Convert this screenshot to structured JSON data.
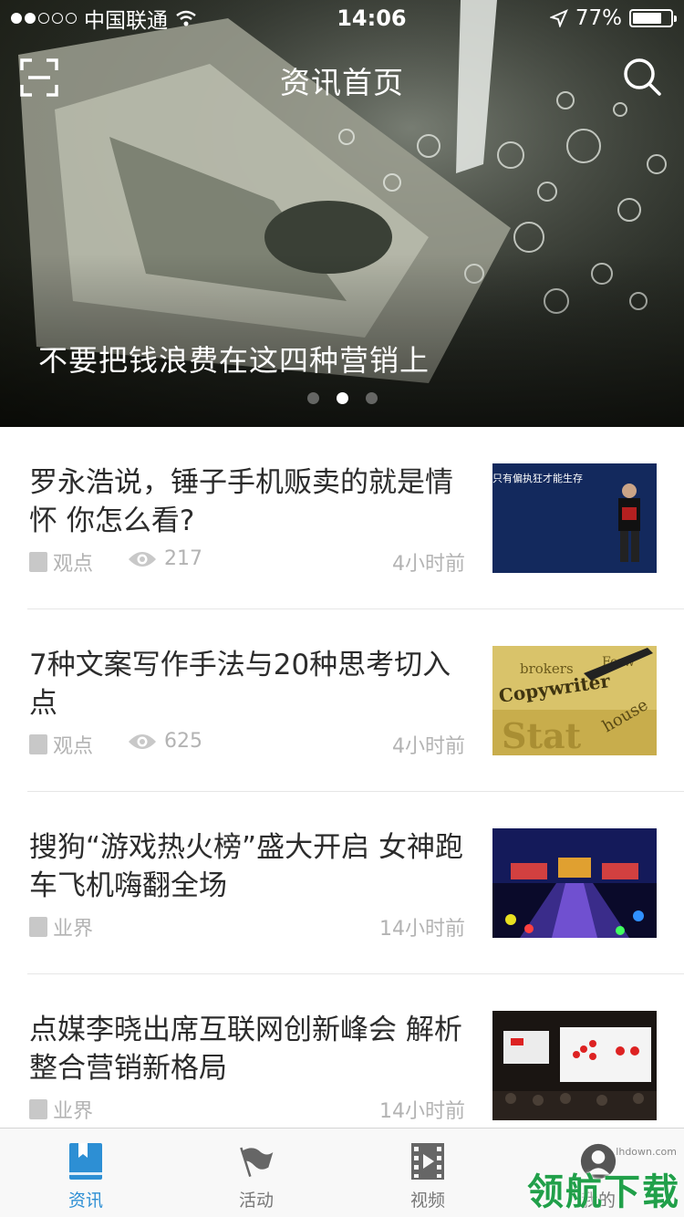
{
  "status_bar": {
    "carrier": "中国联通",
    "time": "14:06",
    "battery": "77%",
    "battery_level": 0.77,
    "signal_bars": 2
  },
  "navbar": {
    "title": "资讯首页",
    "left_icon": "scan-icon",
    "right_icon": "search-icon"
  },
  "banner": {
    "caption": "不要把钱浪费在这四种营销上",
    "page_count": 3,
    "active_page": 2
  },
  "articles": [
    {
      "title": "罗永浩说，锤子手机贩卖的就是情怀 你怎么看?",
      "category": "观点",
      "views": "217",
      "time": "4小时前",
      "thumb_text": "只有偏执狂才能生存"
    },
    {
      "title": "7种文案写作手法与20种思考切入点",
      "category": "观点",
      "views": "625",
      "time": "4小时前",
      "thumb_text": "Copywriter"
    },
    {
      "title": "搜狗“游戏热火榜”盛大开启  女神跑车飞机嗨翻全场",
      "category": "业界",
      "views": "",
      "time": "14小时前",
      "thumb_text": ""
    },
    {
      "title": "点媒李晓出席互联网创新峰会 解析整合营销新格局",
      "category": "业界",
      "views": "",
      "time": "14小时前",
      "thumb_text": ""
    }
  ],
  "tabs": [
    {
      "label": "资讯",
      "icon": "book-icon",
      "active": true
    },
    {
      "label": "活动",
      "icon": "flag-icon",
      "active": false
    },
    {
      "label": "视频",
      "icon": "film-icon",
      "active": false
    },
    {
      "label": "我的",
      "icon": "profile-icon",
      "active": false
    }
  ],
  "watermark": {
    "text": "领航下载",
    "url": "lhdown.com"
  },
  "colors": {
    "accent": "#2d8fd4",
    "watermark": "#21a04a",
    "meta": "#b3b3b3"
  }
}
